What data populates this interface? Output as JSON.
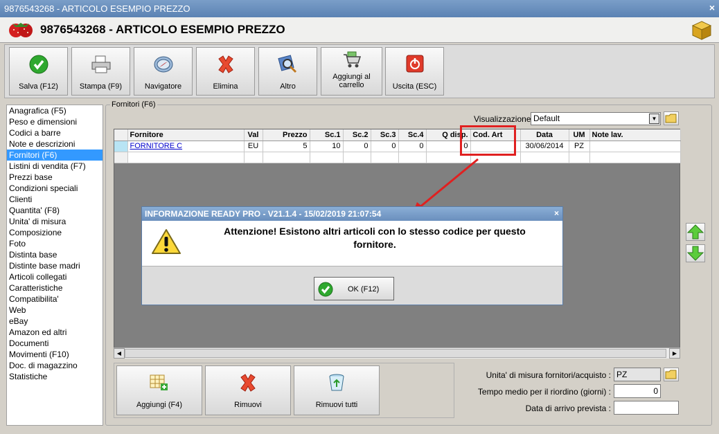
{
  "window": {
    "title": "9876543268 - ARTICOLO ESEMPIO PREZZO",
    "heading": "9876543268 - ARTICOLO ESEMPIO PREZZO",
    "close": "×"
  },
  "toolbar": {
    "save": "Salva (F12)",
    "print": "Stampa (F9)",
    "navigator": "Navigatore",
    "delete": "Elimina",
    "other": "Altro",
    "cart_line1": "Aggiungi al",
    "cart_line2": "carrello",
    "exit": "Uscita (ESC)"
  },
  "sidebar": {
    "items": [
      "Anagrafica (F5)",
      "Peso e dimensioni",
      "Codici a barre",
      "Note e descrizioni",
      "Fornitori (F6)",
      "Listini di vendita (F7)",
      "Prezzi base",
      "Condizioni speciali",
      "Clienti",
      "Quantita' (F8)",
      "Unita' di misura",
      "Composizione",
      "Foto",
      "Distinta base",
      "Distinte base madri",
      "Articoli collegati",
      "Caratteristiche",
      "Compatibilita'",
      "Web",
      "eBay",
      "Amazon ed altri",
      "Documenti",
      "Movimenti (F10)",
      "Doc. di magazzino",
      "Statistiche"
    ],
    "selected_index": 4
  },
  "panel": {
    "group_title": "Fornitori (F6)",
    "view_label": "Visualizzazione :",
    "view_value": "Default"
  },
  "grid": {
    "columns": [
      "Fornitore",
      "Val",
      "Prezzo",
      "Sc.1",
      "Sc.2",
      "Sc.3",
      "Sc.4",
      "Q disp.",
      "Cod. Art",
      "Data",
      "UM",
      "Note lav."
    ],
    "rows": [
      [
        "FORNITORE C",
        "EU",
        "5",
        "10",
        "0",
        "0",
        "0",
        "0",
        "",
        "30/06/2014",
        "PZ",
        ""
      ]
    ]
  },
  "dialog": {
    "title": "INFORMAZIONE READY PRO - V21.1.4 - 15/02/2019 21:07:54",
    "close": "×",
    "message_line1": "Attenzione! Esistono altri articoli con lo stesso codice per questo",
    "message_line2": "fornitore.",
    "ok": "OK (F12)"
  },
  "bottom": {
    "add": "Aggiungi (F4)",
    "remove": "Rimuovi",
    "remove_all": "Rimuovi tutti"
  },
  "fields": {
    "um_label": "Unita' di misura fornitori/acquisto :",
    "um_value": "PZ",
    "lead_label": "Tempo medio per il riordino (giorni) :",
    "lead_value": "0",
    "arrival_label": "Data di arrivo prevista :",
    "arrival_value": ""
  },
  "colors": {
    "selection": "#3399ff",
    "highlight": "#e02020",
    "title_bar": "#6a8fbd"
  }
}
